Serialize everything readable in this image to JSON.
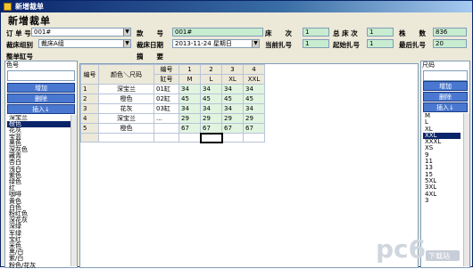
{
  "window": {
    "title": "新增裁单"
  },
  "form": {
    "heading": "新增裁单",
    "order_label": "订 单 号",
    "order_value": "001#",
    "style_label": "款　　号",
    "style_value": "001#",
    "bed_label": "床　　次",
    "bed_value": "1",
    "total_bed_label": "总 床 次",
    "total_bed_value": "1",
    "count_label": "株　　数",
    "count_value": "836",
    "group_label": "裁床组别",
    "group_value": "裁床A组",
    "date_label": "裁床日期",
    "date_value": "2013-11-24 星期日",
    "current_label": "当前扎号",
    "current_value": "1",
    "start_label": "起始扎号",
    "start_value": "1",
    "last_label": "最后扎号",
    "last_value": "20",
    "whole_label": "整单缸号",
    "summary_label": "摘　　要"
  },
  "left_panel": {
    "caption": "色号",
    "add": "增加",
    "delete": "删除",
    "insert": "插入↓",
    "colors": [
      "深宝兰",
      "橙色",
      "花灰",
      "宝蓝",
      "黑色",
      "深灰色",
      "藏青",
      "杏白",
      "浅白",
      "紫色",
      "绿色",
      "红",
      "咖啡",
      "黄色",
      "白色",
      "粉红色",
      "深花灰",
      "深绿",
      "军绿",
      "宝红",
      "米色",
      "黑/白",
      "紫/白",
      "粉色/花灰"
    ],
    "selected_index": 1
  },
  "grid": {
    "header_rowno": "编号",
    "header_color": "颜色＼尺码",
    "header_code": "编号",
    "header_gang": "缸号",
    "size_index": [
      "1",
      "2",
      "3",
      "4"
    ],
    "sizes": [
      "M",
      "L",
      "XL",
      "XXL"
    ],
    "rows": [
      {
        "no": "1",
        "color": "深宝兰",
        "gang": "01缸",
        "v": [
          "34",
          "34",
          "34",
          "34"
        ]
      },
      {
        "no": "2",
        "color": "橙色",
        "gang": "02缸",
        "v": [
          "45",
          "45",
          "45",
          "45"
        ]
      },
      {
        "no": "3",
        "color": "花灰",
        "gang": "03缸",
        "v": [
          "34",
          "34",
          "34",
          "34"
        ]
      },
      {
        "no": "4",
        "color": "深宝兰",
        "gang": "...",
        "v": [
          "29",
          "29",
          "29",
          "29"
        ]
      },
      {
        "no": "5",
        "color": "橙色",
        "gang": "",
        "v": [
          "67",
          "67",
          "67",
          "67"
        ]
      }
    ]
  },
  "right_panel": {
    "caption": "尺码",
    "add": "增加",
    "delete": "删除",
    "insert": "插入↓",
    "sizes": [
      "M",
      "L",
      "XL",
      "XXL",
      "XXXL",
      "XS",
      "9",
      "11",
      "13",
      "15",
      "5XL",
      "3XL",
      "4XL",
      "3"
    ],
    "selected_index": 3
  },
  "watermark": {
    "text": "pc6",
    "sub": "下载站"
  }
}
